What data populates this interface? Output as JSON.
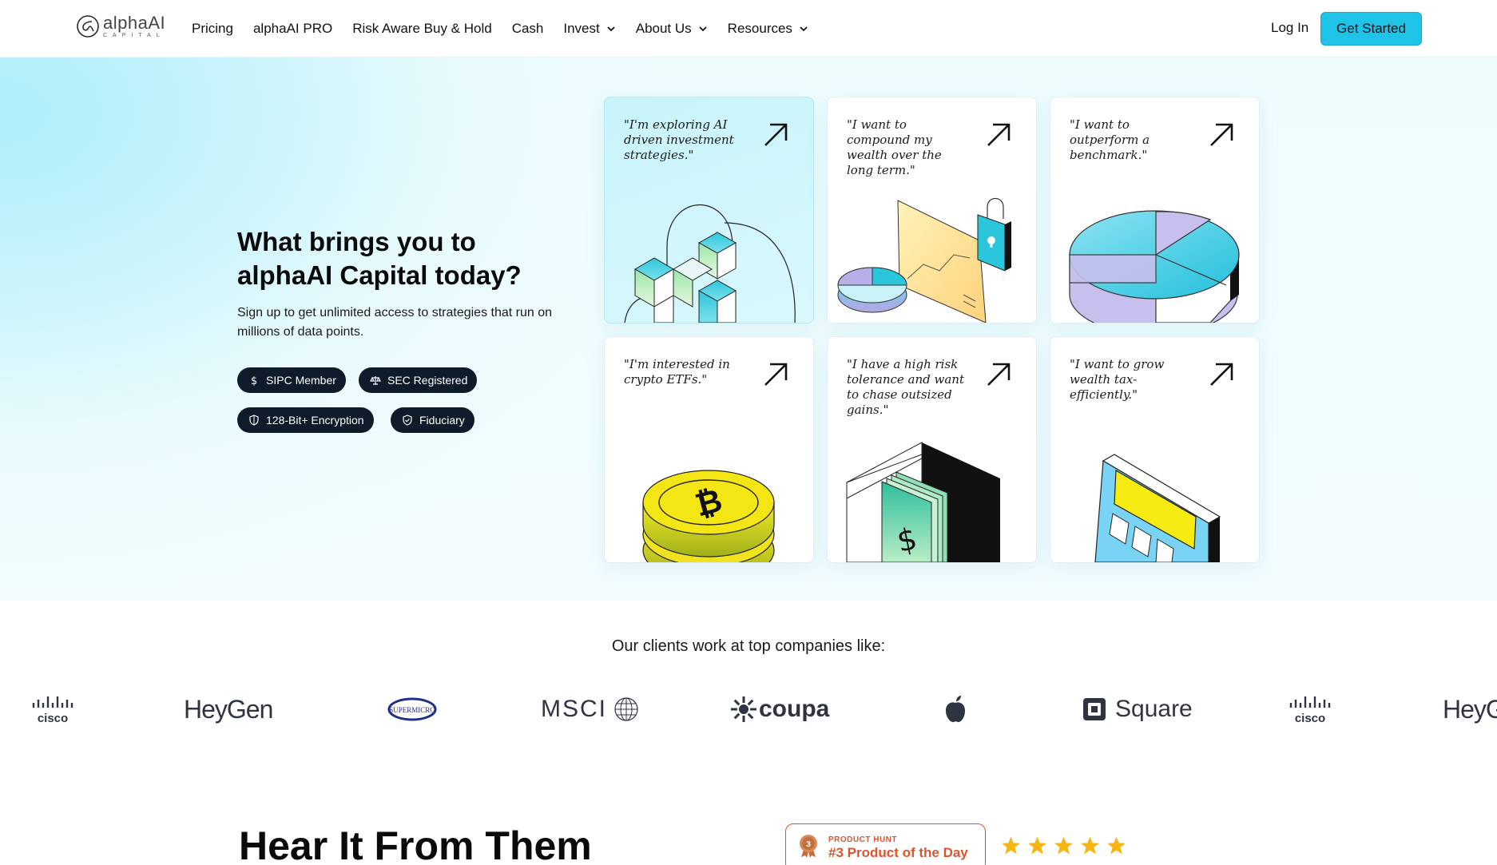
{
  "brand": {
    "name": "alphaAI",
    "sub": "CAPITAL",
    "accent": "#1ec3e7"
  },
  "nav": {
    "items": [
      {
        "label": "Pricing",
        "dropdown": false
      },
      {
        "label": "alphaAI PRO",
        "dropdown": false
      },
      {
        "label": "Risk Aware Buy & Hold",
        "dropdown": false
      },
      {
        "label": "Cash",
        "dropdown": false
      },
      {
        "label": "Invest",
        "dropdown": true
      },
      {
        "label": "About Us",
        "dropdown": true
      },
      {
        "label": "Resources",
        "dropdown": true
      }
    ],
    "login": "Log In",
    "cta": "Get Started"
  },
  "hero": {
    "title": "What brings you to alphaAI Capital today?",
    "subtitle": "Sign up to get unlimited access to strategies that run on millions of data points.",
    "badges": [
      {
        "label": "SIPC Member",
        "icon": "dollar-icon"
      },
      {
        "label": "SEC Registered",
        "icon": "scale-icon"
      },
      {
        "label": "128-Bit+ Encryption",
        "icon": "shield-icon"
      },
      {
        "label": "Fiduciary",
        "icon": "shield-check-icon"
      }
    ]
  },
  "cards": [
    {
      "quote": "\"I'm exploring AI driven investment strategies.\"",
      "illustration": "cubes-network-illustration"
    },
    {
      "quote": "\"I want to compound my wealth over the long term.\"",
      "illustration": "chart-lock-illustration"
    },
    {
      "quote": "\"I want to outperform a benchmark.\"",
      "illustration": "pie-chart-illustration"
    },
    {
      "quote": "\"I'm interested in crypto ETFs.\"",
      "illustration": "bitcoin-coins-illustration"
    },
    {
      "quote": "\"I have a high risk tolerance and want to chase outsized gains.\"",
      "illustration": "cash-box-illustration"
    },
    {
      "quote": "\"I want to grow wealth tax-efficiently.\"",
      "illustration": "calculator-illustration"
    }
  ],
  "clients": {
    "title": "Our clients work at top companies like:",
    "logos": [
      "cisco",
      "HeyGen",
      "SUPERMICRO",
      "MSCI",
      "coupa",
      "apple",
      "Square",
      "cisco",
      "HeyG"
    ]
  },
  "testimonials": {
    "title": "Hear It From Them",
    "product_hunt": {
      "label": "PRODUCT HUNT",
      "title": "#3 Product of the Day",
      "rank": "3"
    },
    "rating_stars": 5
  }
}
